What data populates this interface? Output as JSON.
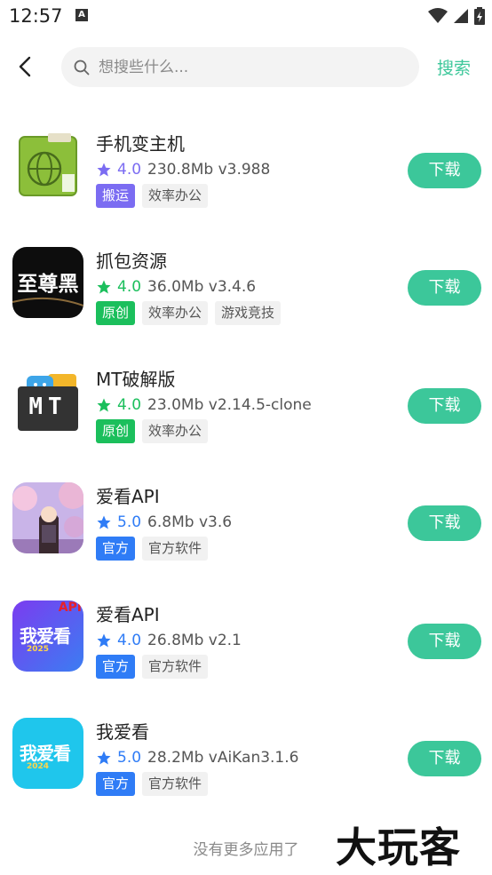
{
  "status_bar": {
    "time": "12:57",
    "notification_icon": "A"
  },
  "header": {
    "search_placeholder": "想搜些什么...",
    "search_label": "搜索"
  },
  "colors": {
    "accent": "#3cc79a",
    "purple": "#7b6cf2",
    "green": "#1bbf5c",
    "blue": "#2f7cf6"
  },
  "apps": [
    {
      "name": "手机变主机",
      "rating": "4.0",
      "size_version": "230.8Mb v3.988",
      "rating_color": "#7b6cf2",
      "tags": [
        "搬运",
        "效率办公"
      ],
      "tag_color": "#7b6cf2",
      "button": "下载"
    },
    {
      "name": "抓包资源",
      "rating": "4.0",
      "size_version": "36.0Mb v3.4.6",
      "rating_color": "#1bbf5c",
      "tags": [
        "原创",
        "效率办公",
        "游戏竞技"
      ],
      "tag_color": "#1bbf5c",
      "button": "下载",
      "icon_text": "至尊黑"
    },
    {
      "name": "MT破解版",
      "rating": "4.0",
      "size_version": "23.0Mb v2.14.5-clone",
      "rating_color": "#1bbf5c",
      "tags": [
        "原创",
        "效率办公"
      ],
      "tag_color": "#1bbf5c",
      "button": "下载",
      "icon_text": "MT"
    },
    {
      "name": "爱看API",
      "rating": "5.0",
      "size_version": "6.8Mb v3.6",
      "rating_color": "#2f7cf6",
      "tags": [
        "官方",
        "官方软件"
      ],
      "tag_color": "#2f7cf6",
      "button": "下载"
    },
    {
      "name": "爱看API",
      "rating": "4.0",
      "size_version": "26.8Mb v2.1",
      "rating_color": "#2f7cf6",
      "tags": [
        "官方",
        "官方软件"
      ],
      "tag_color": "#2f7cf6",
      "button": "下载",
      "icon_text": "我爱看",
      "icon_badge": "API",
      "icon_year": "2025"
    },
    {
      "name": "我爱看",
      "rating": "5.0",
      "size_version": "28.2Mb vAiKan3.1.6",
      "rating_color": "#2f7cf6",
      "tags": [
        "官方",
        "官方软件"
      ],
      "tag_color": "#2f7cf6",
      "button": "下载",
      "icon_text": "我爱看",
      "icon_year": "2024"
    }
  ],
  "footer": {
    "no_more": "没有更多应用了",
    "watermark": "大玩客"
  }
}
